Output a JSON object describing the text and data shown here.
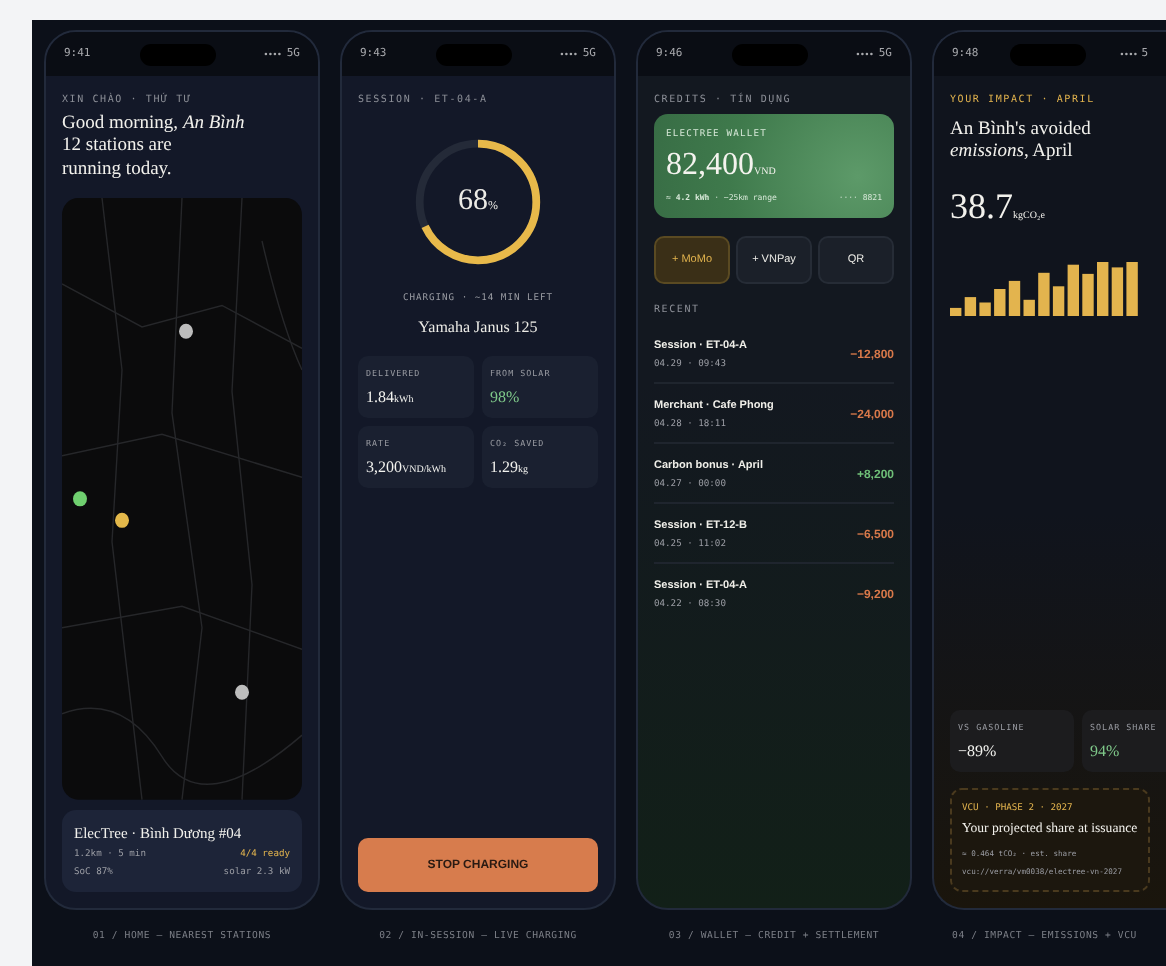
{
  "home": {
    "status_bar": {
      "time": "9:41",
      "network": "5G"
    },
    "eyebrow": "XIN CHÀO · THỨ TƯ",
    "greeting": "Good morning, *An Bình*",
    "subtitle": "12 stations are running today.",
    "station": {
      "name": "ElecTree · Bình Dương #04",
      "distance": "1.2km · 5 min",
      "availability": "4/4 ready",
      "soc": "SoC 87%",
      "solar": "solar 2.3 kW"
    },
    "caption": "01 / HOME — NEAREST STATIONS"
  },
  "session": {
    "status_bar": {
      "time": "9:43",
      "network": "5G"
    },
    "eyebrow": "SESSION · ET-04-A",
    "gauge": {
      "value": "68",
      "unit": "%",
      "level": 0.68
    },
    "status": "CHARGING · ~14 MIN LEFT",
    "vehicle": "Yamaha Janus 125",
    "stats": [
      {
        "label": "DELIVERED",
        "value": "1.84",
        "unit": "kWh",
        "color": "#f2f2ee"
      },
      {
        "label": "FROM SOLAR",
        "value": "98%",
        "color": "#7fc98a"
      },
      {
        "label": "RATE",
        "value": "3,200",
        "unit": "VND/kWh",
        "color": "#f2f2ee"
      },
      {
        "label": "CO₂ SAVED",
        "value": "1.29",
        "unit": "kg",
        "color": "#f2f2ee"
      }
    ],
    "button": "STOP CHARGING",
    "caption": "02 / IN-SESSION — LIVE CHARGING"
  },
  "wallet": {
    "status_bar": {
      "time": "9:46",
      "network": "5G"
    },
    "eyebrow": "CREDITS · TÍN DỤNG",
    "card": {
      "title": "ELECTREE WALLET",
      "balance": "82,400",
      "currency": "VND",
      "detail": "≈ **4.2 kWh** · ~25km range",
      "number": "···· 8821"
    },
    "top_up": [
      {
        "label": "+ MoMo",
        "selected": true
      },
      {
        "label": "+ VNPay",
        "selected": false
      },
      {
        "label": "QR",
        "selected": false
      }
    ],
    "recent_label": "RECENT",
    "transactions": [
      {
        "title": "Session · ET-04-A",
        "date": "04.29 · 09:43",
        "amount": "−12,800",
        "color": "#d9794a"
      },
      {
        "title": "Merchant · Cafe Phong",
        "date": "04.28 · 18:11",
        "amount": "−24,000",
        "color": "#d9794a"
      },
      {
        "title": "Carbon bonus · April",
        "date": "04.27 · 00:00",
        "amount": "+8,200",
        "color": "#6fbf78"
      },
      {
        "title": "Session · ET-12-B",
        "date": "04.25 · 11:02",
        "amount": "−6,500",
        "color": "#d9794a"
      },
      {
        "title": "Session · ET-04-A",
        "date": "04.22 · 08:30",
        "amount": "−9,200",
        "color": "#d9794a"
      }
    ],
    "caption": "03 / WALLET — CREDIT + SETTLEMENT"
  },
  "impact": {
    "status_bar": {
      "time": "9:48",
      "network": "5"
    },
    "eyebrow": "YOUR IMPACT · APRIL",
    "heading": "An Bình's avoided *emissions*, April",
    "total": "38.7",
    "unit": "kgCO₂e",
    "stats": [
      {
        "label": "VS GASOLINE",
        "value": "−89%",
        "color": "#f2f2ee"
      },
      {
        "label": "SOLAR SHARE",
        "value": "94%",
        "color": "#7fc98a"
      }
    ],
    "vcu": {
      "eyebrow": "VCU · PHASE 2 · 2027",
      "title": "Your projected share at issuance",
      "detail": "≈ 0.464 tCO₂ · est. share",
      "uri": "vcu://verra/vm0038/electree-vn-2027"
    },
    "caption": "04 / IMPACT — EMISSIONS + VCU"
  }
}
